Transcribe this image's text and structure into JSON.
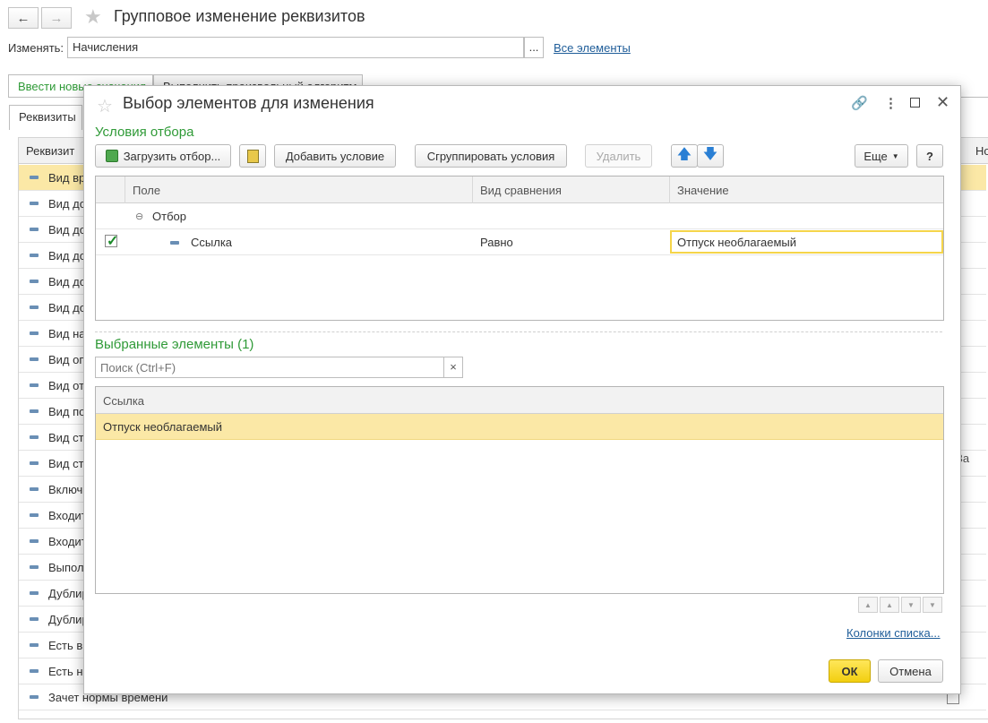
{
  "background": {
    "title": "Групповое изменение реквизитов",
    "change_label": "Изменять:",
    "change_value": "Начисления",
    "ellipsis": "...",
    "all_elements_link": "Все элементы",
    "tabs": [
      "Ввести новые значения",
      "Выполнить произвольный алгоритм"
    ],
    "subtab": "Реквизиты",
    "column_header": "Реквизит",
    "right_header": "Но",
    "right_cell": "За",
    "rows": [
      "Вид вр",
      "Вид до",
      "Вид до",
      "Вид до",
      "Вид до",
      "Вид до",
      "Вид на",
      "Вид оп",
      "Вид от",
      "Вид по",
      "Вид ст",
      "Вид ст",
      "Включ",
      "Входит",
      "Входит",
      "Выпол",
      "Дублир",
      "Дублир",
      "Есть в",
      "Есть н",
      "Зачет нормы времени"
    ]
  },
  "modal": {
    "title": "Выбор элементов для изменения",
    "conditions_title": "Условия отбора",
    "toolbar": {
      "load_filter": "Загрузить отбор...",
      "add_condition": "Добавить условие",
      "group_conditions": "Сгруппировать условия",
      "delete": "Удалить",
      "more": "Еще",
      "help": "?"
    },
    "filter_grid": {
      "headers": {
        "field": "Поле",
        "comparison": "Вид сравнения",
        "value": "Значение"
      },
      "group_row": "Отбор",
      "condition": {
        "field": "Ссылка",
        "comparison": "Равно",
        "value": "Отпуск необлагаемый"
      }
    },
    "selected_title": "Выбранные элементы (1)",
    "search_placeholder": "Поиск (Ctrl+F)",
    "search_clear": "×",
    "list": {
      "header": "Ссылка",
      "rows": [
        "Отпуск необлагаемый"
      ]
    },
    "columns_link": "Колонки списка...",
    "ok": "ОК",
    "cancel": "Отмена"
  }
}
